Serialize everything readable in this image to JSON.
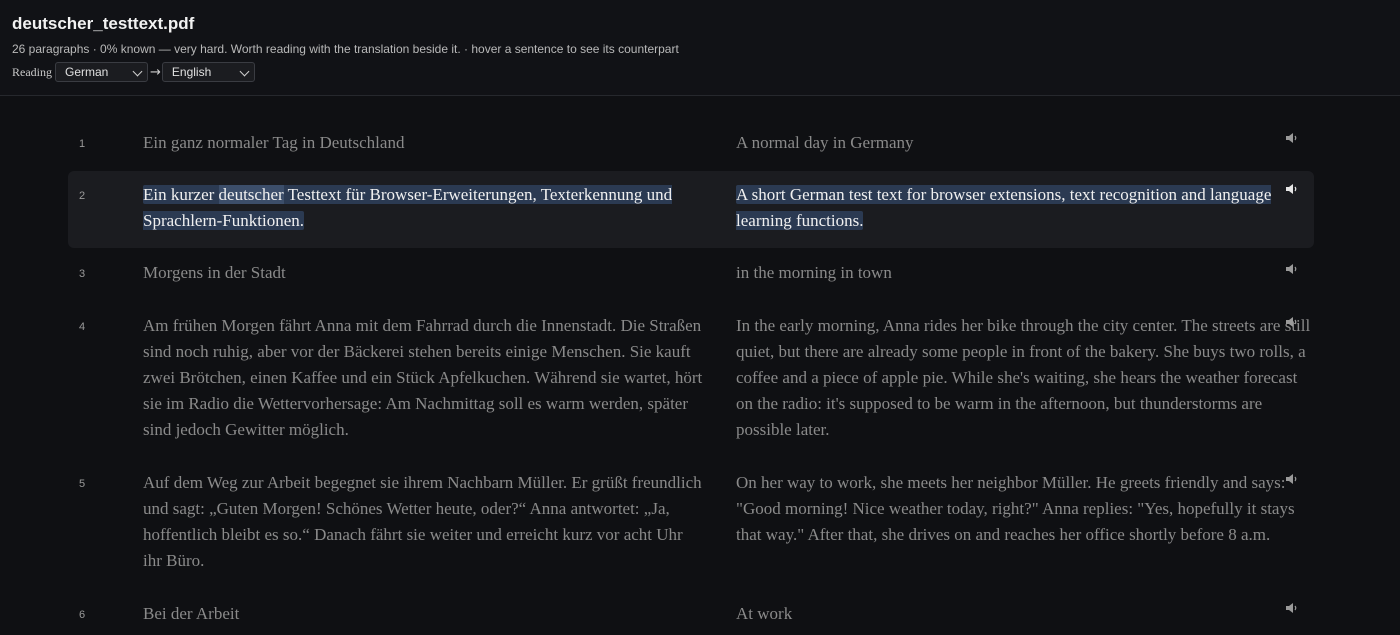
{
  "header": {
    "title": "deutscher_testtext.pdf",
    "subtitle": "26 paragraphs · 0% known — very hard. Worth reading with the translation beside it. · hover a sentence to see its counterpart",
    "reading_label": "Reading",
    "source_language": "German",
    "target_language": "English",
    "arrow": "→"
  },
  "rows": [
    {
      "num": "1",
      "de": "Ein ganz normaler Tag in Deutschland",
      "en": "A normal day in Germany"
    },
    {
      "num": "2",
      "de_before": "Ein kurzer ",
      "de_word": "deutscher",
      "de_after": " Testtext für Browser-Erweiterungen, Texterkennung und Sprachlern-Funktionen.",
      "en": "A short German test text for browser extensions, text recognition and language learning functions."
    },
    {
      "num": "3",
      "de": "Morgens in der Stadt",
      "en": "in the morning in town"
    },
    {
      "num": "4",
      "de": "Am frühen Morgen fährt Anna mit dem Fahrrad durch die Innenstadt. Die Straßen sind noch ruhig, aber vor der Bäckerei stehen bereits einige Menschen. Sie kauft zwei Brötchen, einen Kaffee und ein Stück Apfelkuchen. Während sie wartet, hört sie im Radio die Wettervorhersage: Am Nachmittag soll es warm werden, später sind jedoch Gewitter möglich.",
      "en": "In the early morning, Anna rides her bike through the city center. The streets are still quiet, but there are already some people in front of the bakery. She buys two rolls, a coffee and a piece of apple pie. While she's waiting, she hears the weather forecast on the radio: it's supposed to be warm in the afternoon, but thunderstorms are possible later."
    },
    {
      "num": "5",
      "de": "Auf dem Weg zur Arbeit begegnet sie ihrem Nachbarn Müller. Er grüßt freundlich und sagt: „Guten Morgen! Schönes Wetter heute, oder?“ Anna antwortet: „Ja, hoffentlich bleibt es so.“ Danach fährt sie weiter und erreicht kurz vor acht Uhr ihr Büro.",
      "en": "On her way to work, she meets her neighbor Müller. He greets friendly and says: \"Good morning! Nice weather today, right?\" Anna replies: \"Yes, hopefully it stays that way.\" After that, she drives on and reaches her office shortly before 8 a.m."
    },
    {
      "num": "6",
      "de": "Bei der Arbeit",
      "en": "At work"
    }
  ],
  "speaker_icon": "speaker-icon",
  "colors": {
    "background": "#0f1013",
    "active_row": "#1b1c20",
    "highlight": "#2b3a52",
    "dim_text": "#8a8a8a"
  }
}
